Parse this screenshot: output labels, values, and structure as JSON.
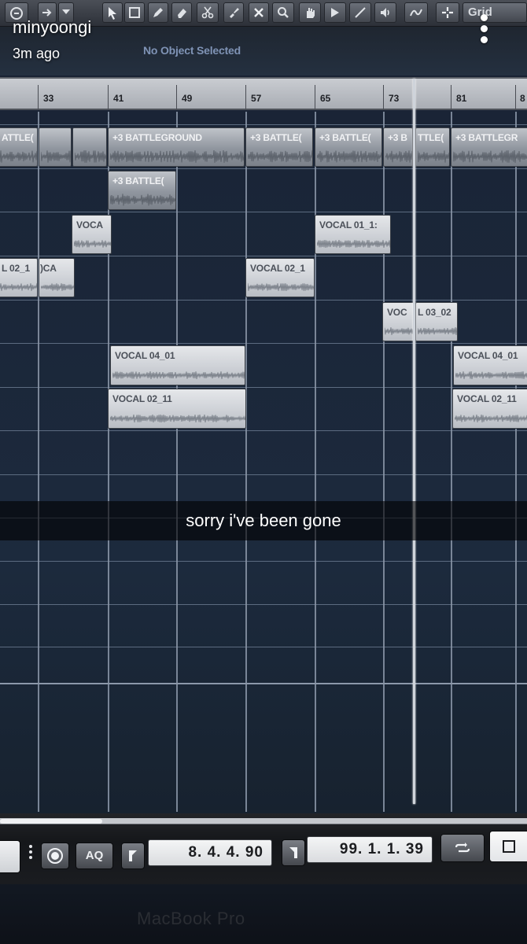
{
  "snap": {
    "username": "minyoongi",
    "time_ago": "3m ago",
    "caption": "sorry i've been gone",
    "menu_icon": "more-vertical-icon"
  },
  "daw": {
    "toolbar": {
      "grid_label": "Grid",
      "icons": [
        "edit-icon",
        "arrow-right-icon",
        "dropdown-icon",
        "pointer-icon",
        "select-icon",
        "pencil-icon",
        "eraser-icon",
        "scissors-icon",
        "glue-icon",
        "mute-x-icon",
        "zoom-icon",
        "hand-icon",
        "play-audition-icon",
        "line-icon",
        "speaker-icon",
        "snap-curve-icon",
        "snap-grid-icon"
      ]
    },
    "info_line": "No Object Selected",
    "ruler": {
      "bars": [
        "33",
        "41",
        "49",
        "57",
        "65",
        "73",
        "81",
        "8"
      ]
    },
    "clips": {
      "battleground_main": "+3 BATTLEGROUND",
      "battleground_short_1": "+3 BATTLE(",
      "battleground_short_2": "+3 BATTLE(",
      "battleground_short_3": "+3 B",
      "battleground_short_4": "TTLE(",
      "battleground_tail": "+3 BATTLEGR",
      "battleground_left": "ATTLE(",
      "battleground_lane2": "+3 BATTLE(",
      "vocal_a": "VOCA",
      "vocal_01_1": "VOCAL 01_1:",
      "vocal_02_left": "L 02_1",
      "vocal_02_left_b": ")CA",
      "vocal_02_1": "VOCAL 02_1",
      "vocal_03_02_a": "VOC",
      "vocal_03_02_b": "L 03_02",
      "vocal_04_01": "VOCAL 04_01",
      "vocal_04_01_right": "VOCAL 04_01",
      "vocal_02_11": "VOCAL 02_11",
      "vocal_02_11_right": "VOCAL 02_11"
    },
    "transport": {
      "aq_label": "AQ",
      "left_locator": "8. 4. 4. 90",
      "right_locator": "99. 1. 1. 39",
      "icons": [
        "menu-dots-icon",
        "record-mode-icon",
        "left-locator-icon",
        "right-locator-icon",
        "cycle-icon",
        "stop-icon"
      ]
    },
    "bezel_text": "MacBook Pro"
  }
}
